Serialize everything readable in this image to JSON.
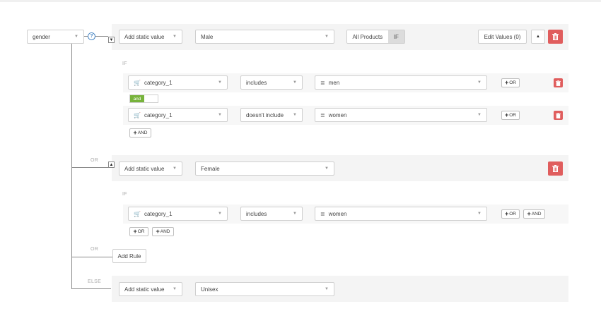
{
  "root_field": {
    "label": "gender"
  },
  "help_icon": "question-circle-icon",
  "rule1": {
    "value_type": "Add static value",
    "value": "Male",
    "segment": {
      "all_products": "All Products",
      "if": "IF"
    },
    "edit_values": "Edit Values (0)",
    "if_label": "IF",
    "conditions": [
      {
        "field": "category_1",
        "operator": "includes",
        "value": "men",
        "or_label": "OR"
      },
      {
        "field": "category_1",
        "operator": "doesn't include",
        "value": "women",
        "or_label": "OR"
      }
    ],
    "and_toggle": "and",
    "add_and": "AND"
  },
  "rule2": {
    "or_label": "OR",
    "value_type": "Add static value",
    "value": "Female",
    "if_label": "IF",
    "condition": {
      "field": "category_1",
      "operator": "includes",
      "value": "women",
      "or_label": "OR",
      "and_label": "AND"
    },
    "add_or": "OR",
    "add_and": "AND"
  },
  "add_rule": {
    "or_label": "OR",
    "button": "Add Rule"
  },
  "else_rule": {
    "else_label": "ELSE",
    "value_type": "Add static value",
    "value": "Unisex"
  },
  "colors": {
    "delete": "#e05d5d",
    "and_toggle": "#77b33b",
    "help": "#4a87c5"
  }
}
